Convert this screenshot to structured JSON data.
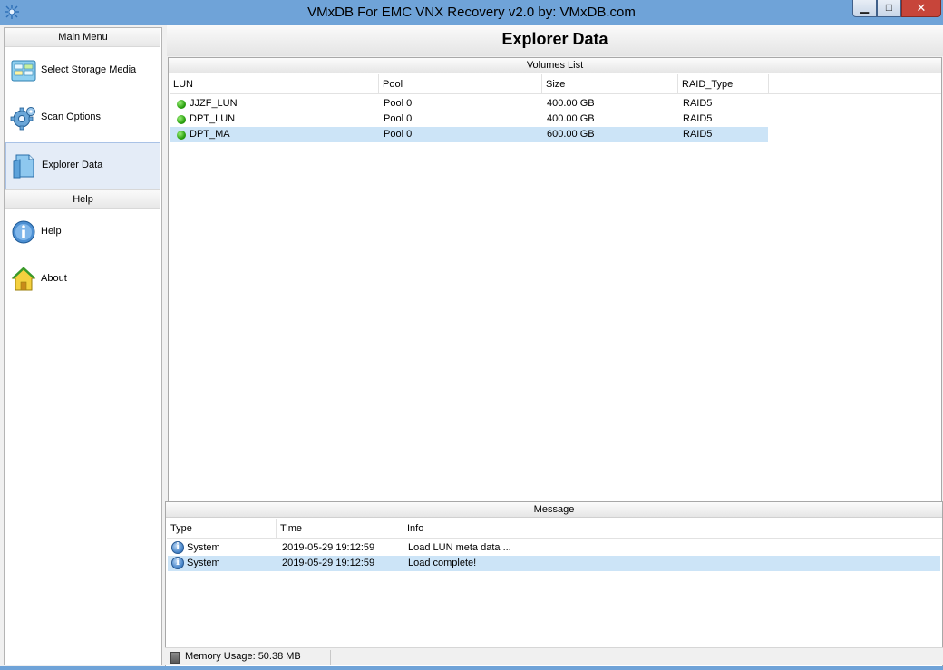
{
  "window": {
    "title": "VMxDB For EMC VNX Recovery v2.0 by: VMxDB.com",
    "controls": {
      "minimize": "▁",
      "maximize": "□",
      "close": "✕"
    }
  },
  "sidebar": {
    "main_menu_label": "Main Menu",
    "help_label": "Help",
    "items": [
      {
        "label": "Select Storage Media",
        "icon": "storage-media-icon"
      },
      {
        "label": "Scan Options",
        "icon": "gear-icon"
      },
      {
        "label": "Explorer Data",
        "icon": "document-icon",
        "active": true
      }
    ],
    "help_items": [
      {
        "label": "Help",
        "icon": "info-icon"
      },
      {
        "label": "About",
        "icon": "home-icon"
      }
    ]
  },
  "main": {
    "title": "Explorer Data",
    "volumes": {
      "caption": "Volumes List",
      "columns": [
        "LUN",
        "Pool",
        "Size",
        "RAID_Type"
      ],
      "rows": [
        {
          "lun": "JJZF_LUN",
          "pool": "Pool 0",
          "size": "400.00 GB",
          "raid": "RAID5",
          "status_color": "#2aa10f"
        },
        {
          "lun": "DPT_LUN",
          "pool": "Pool 0",
          "size": "400.00 GB",
          "raid": "RAID5",
          "status_color": "#2aa10f"
        },
        {
          "lun": "DPT_MA",
          "pool": "Pool 0",
          "size": "600.00 GB",
          "raid": "RAID5",
          "status_color": "#2aa10f",
          "selected": true
        }
      ]
    },
    "message": {
      "caption": "Message",
      "columns": [
        "Type",
        "Time",
        "Info"
      ],
      "rows": [
        {
          "type": "System",
          "time": "2019-05-29 19:12:59",
          "info": "Load LUN meta data ..."
        },
        {
          "type": "System",
          "time": "2019-05-29 19:12:59",
          "info": "Load complete!",
          "selected": true
        }
      ]
    }
  },
  "status": {
    "memory": "Memory Usage: 50.38 MB"
  },
  "colors": {
    "titlebar": "#6fa3d8",
    "selection": "#cce4f7",
    "ok_status": "#2aa10f"
  }
}
